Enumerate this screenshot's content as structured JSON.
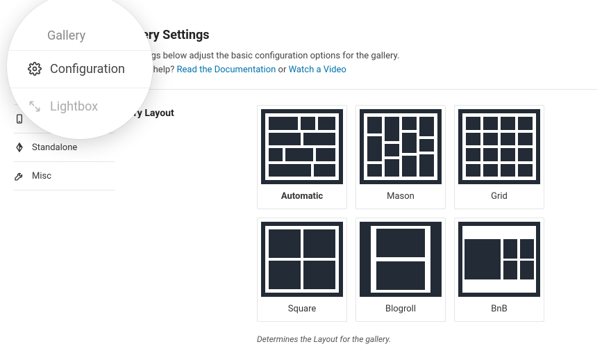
{
  "magnifier": {
    "top_label": "Gallery",
    "center_label": "Configuration",
    "bottom_label": "Lightbox"
  },
  "sidebar": {
    "items": [
      {
        "label": "Mobile"
      },
      {
        "label": "Standalone"
      },
      {
        "label": "Misc"
      }
    ]
  },
  "main": {
    "title_suffix": "allery Settings",
    "desc1_suffix": "settings below adjust the basic configuration options for the gallery.",
    "help_prefix": "some help? ",
    "doc_link": "Read the Documentation",
    "help_or": " or ",
    "video_link": "Watch a Video",
    "row_label_suffix": "ery Layout",
    "layouts": [
      {
        "label": "Automatic",
        "selected": true
      },
      {
        "label": "Mason"
      },
      {
        "label": "Grid"
      },
      {
        "label": "Square"
      },
      {
        "label": "Blogroll"
      },
      {
        "label": "BnB"
      }
    ],
    "helper": "Determines the Layout for the gallery."
  }
}
